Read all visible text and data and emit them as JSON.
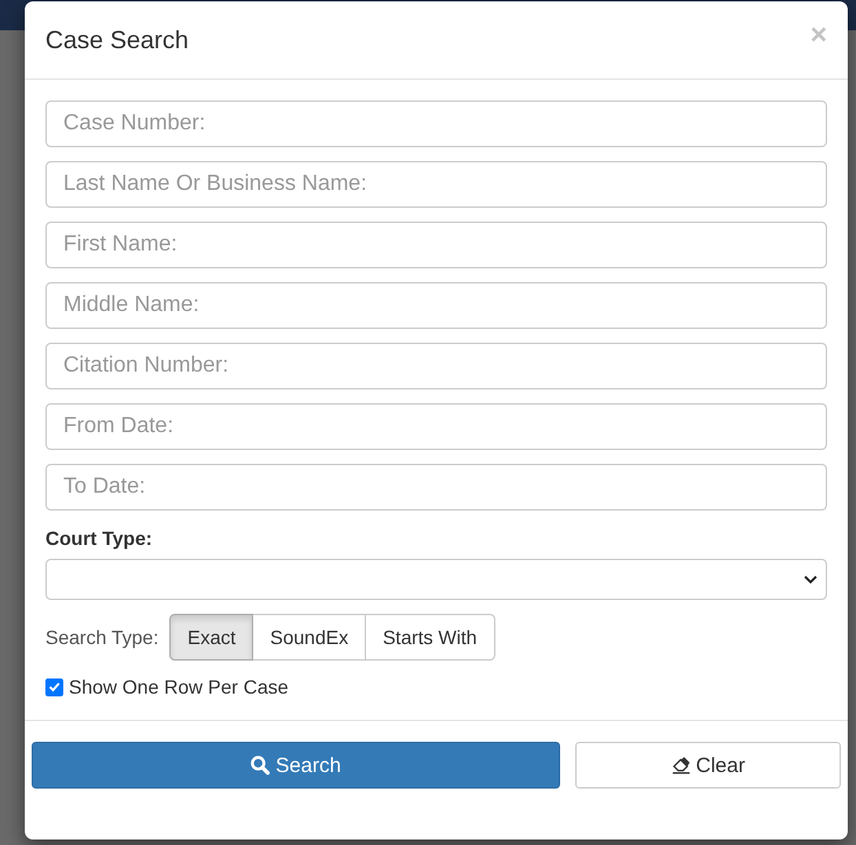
{
  "modal": {
    "title": "Case Search",
    "close": "×"
  },
  "fields": [
    {
      "placeholder": "Case Number:"
    },
    {
      "placeholder": "Last Name Or Business Name:"
    },
    {
      "placeholder": "First Name:"
    },
    {
      "placeholder": "Middle Name:"
    },
    {
      "placeholder": "Citation Number:"
    },
    {
      "placeholder": "From Date:"
    },
    {
      "placeholder": "To Date:"
    }
  ],
  "court_type": {
    "label": "Court Type:"
  },
  "search_type": {
    "label": "Search Type:",
    "options": [
      {
        "label": "Exact",
        "selected": true
      },
      {
        "label": "SoundEx",
        "selected": false
      },
      {
        "label": "Starts With",
        "selected": false
      }
    ]
  },
  "show_one_row": {
    "label": "Show One Row Per Case",
    "checked": true
  },
  "buttons": [
    {
      "label": "Search",
      "kind": "primary"
    },
    {
      "label": "Clear",
      "kind": "default"
    }
  ]
}
